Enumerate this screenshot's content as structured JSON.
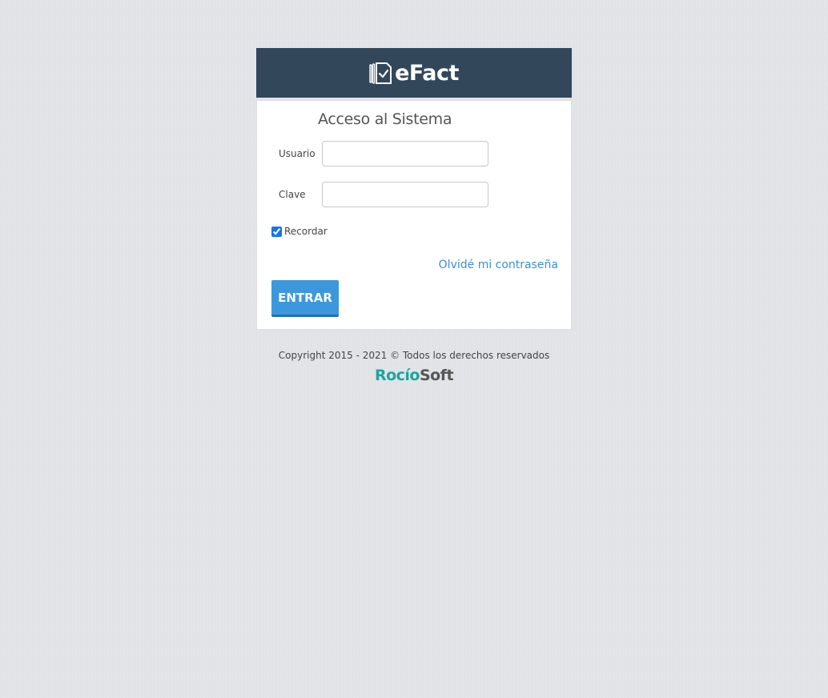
{
  "header": {
    "logo_text": "eFact",
    "logo_icon": "document-check-icon",
    "background_color": "#33475b"
  },
  "login": {
    "title": "Acceso al Sistema",
    "username_label": "Usuario",
    "username_value": "",
    "password_label": "Clave",
    "password_value": "",
    "remember_label": "Recordar",
    "remember_checked": true,
    "forgot_link": "Olvidé mi contraseña",
    "submit_label": "ENTRAR"
  },
  "footer": {
    "copyright": "Copyright 2015 - 2021 © Todos los derechos reservados",
    "brand_part_1": "Rocío",
    "brand_part_2": "Soft",
    "brand_color_1": "#1aa6a0",
    "brand_color_2": "#555555"
  },
  "colors": {
    "accent": "#3b98dc",
    "link": "#3a8fd6",
    "page_background": "#e4e5e8"
  }
}
